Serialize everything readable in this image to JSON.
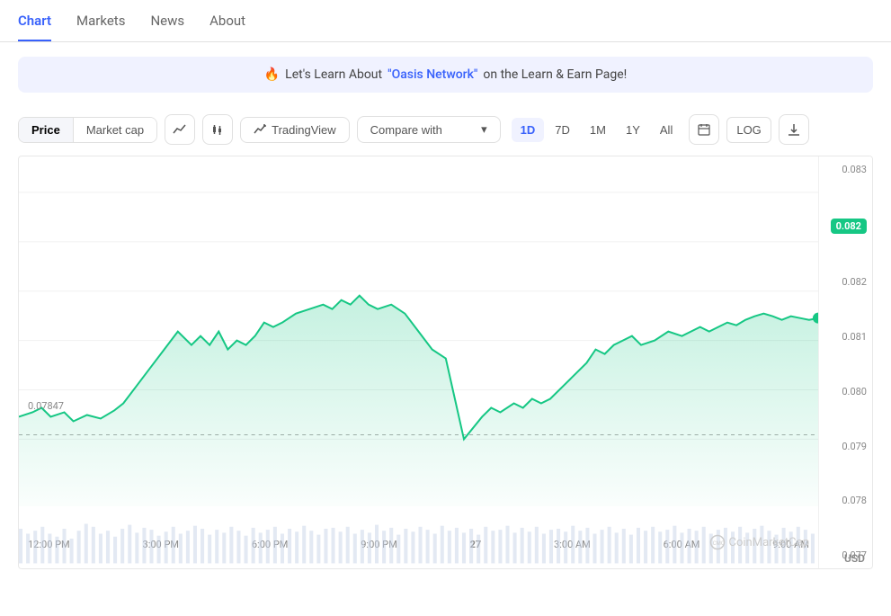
{
  "nav": {
    "tabs": [
      {
        "label": "Chart",
        "active": true
      },
      {
        "label": "Markets",
        "active": false
      },
      {
        "label": "News",
        "active": false
      },
      {
        "label": "About",
        "active": false
      }
    ]
  },
  "banner": {
    "icon": "🔥",
    "text_before": "Let's Learn About ",
    "link_text": "\"Oasis Network\"",
    "text_after": " on the Learn & Earn Page!"
  },
  "toolbar": {
    "price_label": "Price",
    "market_cap_label": "Market cap",
    "chart_type_line": "line-chart-icon",
    "chart_type_candle": "candle-chart-icon",
    "tradingview_label": "TradingView",
    "compare_label": "Compare with",
    "time_buttons": [
      "1D",
      "7D",
      "1M",
      "1Y",
      "All"
    ],
    "active_time": "1D",
    "calendar_icon": "calendar-icon",
    "log_label": "LOG",
    "download_icon": "download-icon"
  },
  "chart": {
    "y_labels": [
      "0.083",
      "0.082",
      "0.082",
      "0.081",
      "0.080",
      "0.079",
      "0.078",
      "0.077"
    ],
    "current_price": "0.082",
    "min_price": "0.07847",
    "x_labels": [
      "12:00 PM",
      "3:00 PM",
      "6:00 PM",
      "9:00 PM",
      "27",
      "3:00 AM",
      "6:00 AM",
      "9:00 AM"
    ],
    "usd_label": "USD",
    "watermark": "CoinMarketCap"
  }
}
